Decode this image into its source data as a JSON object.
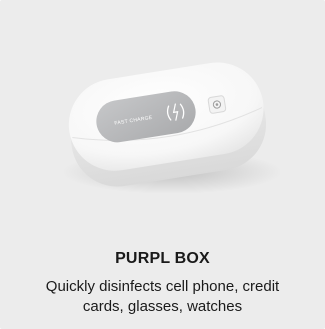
{
  "product": {
    "name": "PURPL BOX",
    "description": "Quickly disinfects cell phone, credit cards, glasses, watches",
    "device_label": "FAST CHARGE"
  },
  "colors": {
    "card_background": "#ececec",
    "device_body": "#f7f7f7",
    "charge_pad": "#b9babc",
    "text": "#1a1a1a"
  },
  "icons": [
    "wireless-charge-icon",
    "power-button-icon"
  ]
}
